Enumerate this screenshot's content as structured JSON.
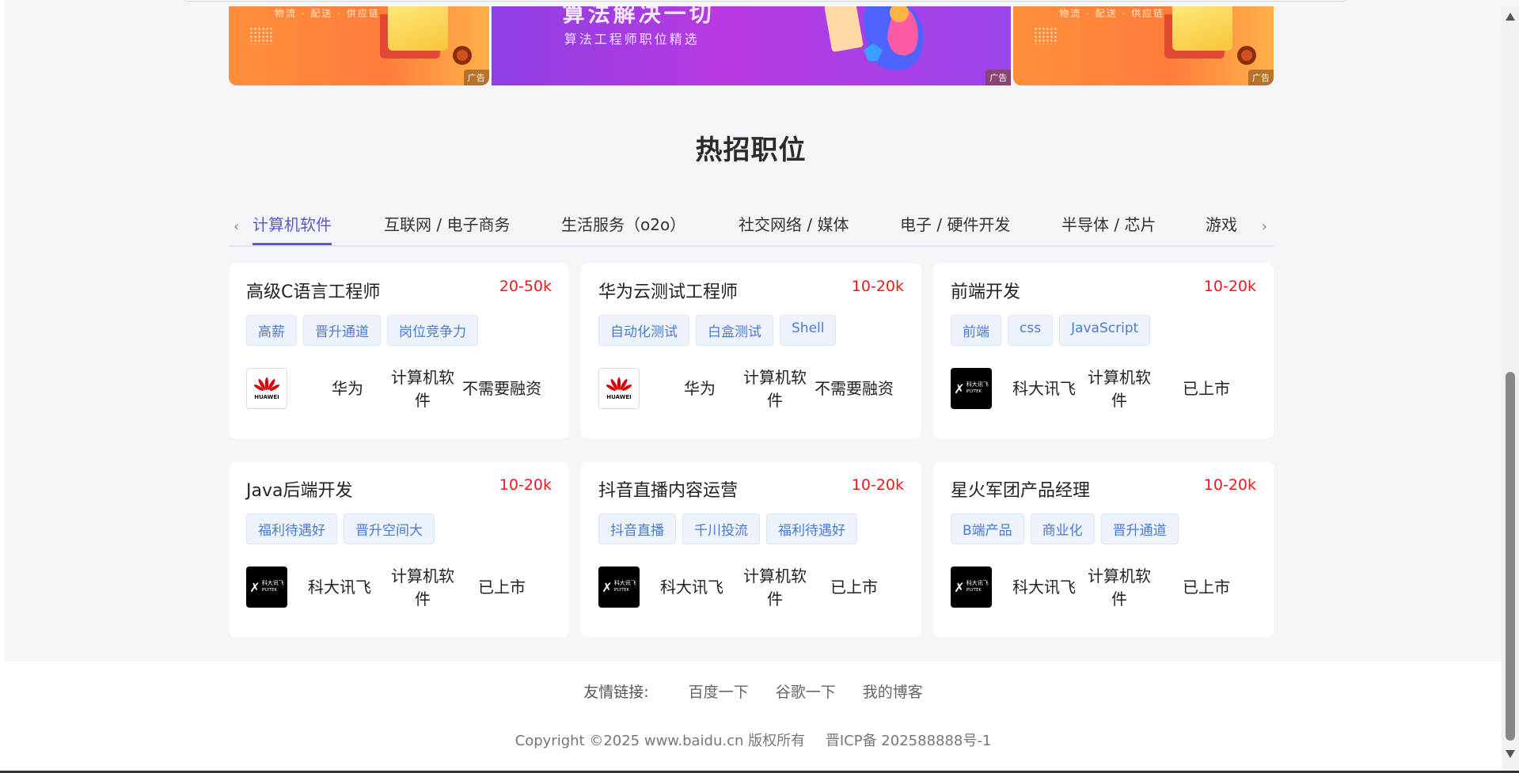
{
  "ads": [
    {
      "small_text": "物流 · 配送 · 供应链",
      "tag": "广告"
    },
    {
      "title": "算法解决一切",
      "subtitle": "算法工程师职位精选",
      "tag": "广告"
    },
    {
      "small_text": "物流 · 配送 · 供应链",
      "tag": "广告"
    }
  ],
  "section": {
    "title": "热招职位"
  },
  "tabs": [
    {
      "label": "计算机软件",
      "active": true
    },
    {
      "label": "互联网 / 电子商务"
    },
    {
      "label": "生活服务（o2o）"
    },
    {
      "label": "社交网络 / 媒体"
    },
    {
      "label": "电子 / 硬件开发"
    },
    {
      "label": "半导体 / 芯片"
    },
    {
      "label": "游戏"
    }
  ],
  "jobs": [
    {
      "title": "高级C语言工程师",
      "salary": "20-50k",
      "tags": [
        "高薪",
        "晋升通道",
        "岗位竞争力"
      ],
      "company": "华为",
      "logo": "huawei-logo",
      "industry_line1": "计算机软",
      "industry_line2": "件",
      "status": "不需要融资"
    },
    {
      "title": "华为云测试工程师",
      "salary": "10-20k",
      "tags": [
        "自动化测试",
        "白盒测试",
        "Shell"
      ],
      "company": "华为",
      "logo": "huawei-logo",
      "industry_line1": "计算机软",
      "industry_line2": "件",
      "status": "不需要融资"
    },
    {
      "title": "前端开发",
      "salary": "10-20k",
      "tags": [
        "前端",
        "css",
        "JavaScript"
      ],
      "company": "科大讯飞",
      "logo": "iflytek-logo",
      "industry_line1": "计算机软",
      "industry_line2": "件",
      "status": "已上市"
    },
    {
      "title": "Java后端开发",
      "salary": "10-20k",
      "tags": [
        "福利待遇好",
        "晋升空间大"
      ],
      "company": "科大讯飞",
      "logo": "iflytek-logo",
      "industry_line1": "计算机软",
      "industry_line2": "件",
      "status": "已上市"
    },
    {
      "title": "抖音直播内容运营",
      "salary": "10-20k",
      "tags": [
        "抖音直播",
        "千川投流",
        "福利待遇好"
      ],
      "company": "科大讯飞",
      "logo": "iflytek-logo",
      "industry_line1": "计算机软",
      "industry_line2": "件",
      "status": "已上市"
    },
    {
      "title": "星火军团产品经理",
      "salary": "10-20k",
      "tags": [
        "B端产品",
        "商业化",
        "晋升通道"
      ],
      "company": "科大讯飞",
      "logo": "iflytek-logo",
      "industry_line1": "计算机软",
      "industry_line2": "件",
      "status": "已上市"
    }
  ],
  "logos": {
    "huawei_text": "HUAWEI",
    "iflytek_cn": "科大讯飞",
    "iflytek_en": "IFLYTEK"
  },
  "footer": {
    "links_label": "友情链接:",
    "links": [
      "百度一下",
      "谷歌一下",
      "我的博客"
    ],
    "copyright": "Copyright ©2025 www.baidu.cn 版权所有",
    "icp": "晋ICP备 202588888号-1"
  },
  "colors": {
    "accent": "#5b59c8",
    "salary": "#f0181b",
    "tag_text": "#4a7ccf",
    "tag_bg": "#edf2fb"
  }
}
